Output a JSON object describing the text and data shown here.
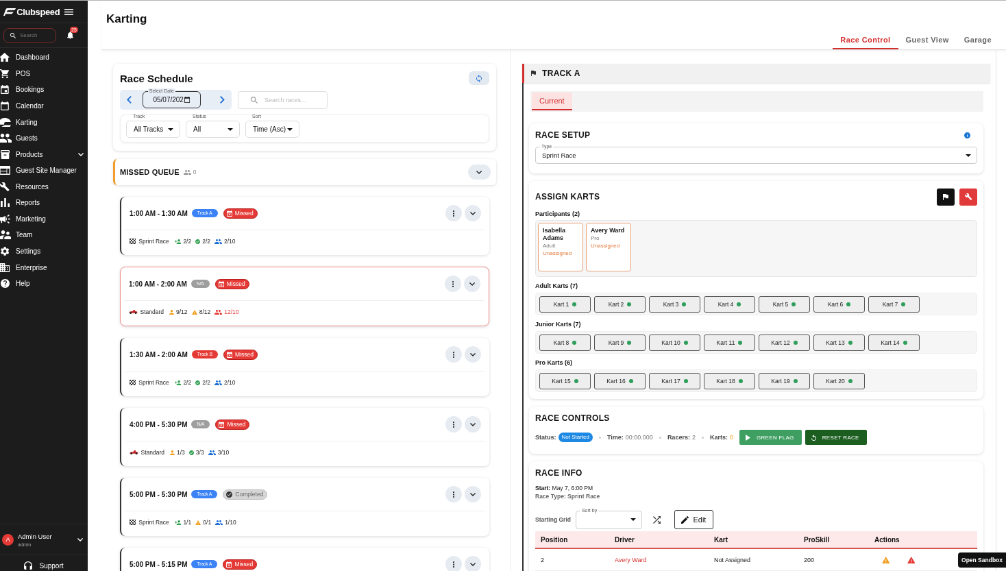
{
  "sidebar": {
    "brand": "Clubspeed",
    "search": {
      "placeholder": "Search"
    },
    "notification_count": "25",
    "items": [
      {
        "label": "Dashboard",
        "has_submenu": false
      },
      {
        "label": "POS",
        "has_submenu": false
      },
      {
        "label": "Bookings",
        "has_submenu": false
      },
      {
        "label": "Calendar",
        "has_submenu": false
      },
      {
        "label": "Karting",
        "has_submenu": false
      },
      {
        "label": "Guests",
        "has_submenu": false
      },
      {
        "label": "Products",
        "has_submenu": true
      },
      {
        "label": "Guest Site Manager",
        "has_submenu": false
      },
      {
        "label": "Resources",
        "has_submenu": false
      },
      {
        "label": "Reports",
        "has_submenu": false
      },
      {
        "label": "Marketing",
        "has_submenu": false
      },
      {
        "label": "Team",
        "has_submenu": false
      },
      {
        "label": "Settings",
        "has_submenu": false
      },
      {
        "label": "Enterprise",
        "has_submenu": false
      },
      {
        "label": "Help",
        "has_submenu": false
      }
    ],
    "user": {
      "initial": "A",
      "name": "Admin User",
      "role": "admin"
    },
    "support": "Support"
  },
  "header": {
    "title": "Karting",
    "tabs": [
      {
        "label": "Race Control",
        "selected": true
      },
      {
        "label": "Guest View",
        "selected": false
      },
      {
        "label": "Garage",
        "selected": false
      }
    ]
  },
  "schedule": {
    "title": "Race Schedule",
    "date": {
      "label": "Select Date",
      "value": "05/07/202"
    },
    "search": {
      "placeholder": "Search races..."
    },
    "filters": [
      {
        "label": "Track",
        "value": "All Tracks"
      },
      {
        "label": "Status",
        "value": "All"
      },
      {
        "label": "Sort",
        "value": "Time (Asc)"
      }
    ]
  },
  "missed_queue": {
    "title": "MISSED QUEUE",
    "count": "0"
  },
  "races": [
    {
      "time": "1:00 AM - 1:30 AM",
      "track": {
        "label": "Track A",
        "color": "#3b82f6"
      },
      "status": {
        "label": "Missed",
        "kind": "missed"
      },
      "alert": false,
      "type": {
        "label": "Sprint Race",
        "kind": "sprint"
      },
      "stats": [
        {
          "kind": "checkin",
          "value": "2/2",
          "alert": false
        },
        {
          "kind": "ready",
          "value": "2/2",
          "alert": false
        },
        {
          "kind": "capacity",
          "value": "2/10",
          "alert": false
        }
      ]
    },
    {
      "time": "1:00 AM - 2:00 AM",
      "track": {
        "label": "N/A",
        "color": "#9e9e9e"
      },
      "status": {
        "label": "Missed",
        "kind": "missed"
      },
      "alert": true,
      "type": {
        "label": "Standard",
        "kind": "standard"
      },
      "stats": [
        {
          "kind": "checkin",
          "value": "9/12",
          "alert": true
        },
        {
          "kind": "ready",
          "value": "8/12",
          "alert": true
        },
        {
          "kind": "capacity",
          "value": "12/10",
          "alert": true
        }
      ]
    },
    {
      "time": "1:30 AM - 2:00 AM",
      "track": {
        "label": "Track B",
        "color": "#e53935"
      },
      "status": {
        "label": "Missed",
        "kind": "missed"
      },
      "alert": false,
      "type": {
        "label": "Sprint Race",
        "kind": "sprint"
      },
      "stats": [
        {
          "kind": "checkin",
          "value": "2/2",
          "alert": false
        },
        {
          "kind": "ready",
          "value": "2/2",
          "alert": false
        },
        {
          "kind": "capacity",
          "value": "2/10",
          "alert": false
        }
      ]
    },
    {
      "time": "4:00 PM - 5:30 PM",
      "track": {
        "label": "N/A",
        "color": "#9e9e9e"
      },
      "status": {
        "label": "Missed",
        "kind": "missed"
      },
      "alert": false,
      "type": {
        "label": "Standard",
        "kind": "standard"
      },
      "stats": [
        {
          "kind": "checkin",
          "value": "1/3",
          "alert": true
        },
        {
          "kind": "ready",
          "value": "3/3",
          "alert": false
        },
        {
          "kind": "capacity",
          "value": "3/10",
          "alert": false
        }
      ]
    },
    {
      "time": "5:00 PM - 5:30 PM",
      "track": {
        "label": "Track A",
        "color": "#3b82f6"
      },
      "status": {
        "label": "Completed",
        "kind": "completed"
      },
      "alert": false,
      "type": {
        "label": "Sprint Race",
        "kind": "sprint"
      },
      "stats": [
        {
          "kind": "checkin",
          "value": "1/1",
          "alert": false
        },
        {
          "kind": "ready",
          "value": "0/1",
          "alert": true
        },
        {
          "kind": "capacity",
          "value": "1/10",
          "alert": false
        }
      ]
    },
    {
      "time": "5:00 PM - 5:15 PM",
      "track": {
        "label": "Track A",
        "color": "#3b82f6"
      },
      "status": {
        "label": "Missed",
        "kind": "missed"
      },
      "alert": false
    }
  ],
  "track_panel": {
    "title": "TRACK A",
    "tabs": [
      {
        "label": "Current",
        "selected": true
      }
    ],
    "race_setup": {
      "title": "RACE SETUP",
      "type": {
        "label": "Type",
        "value": "Sprint Race"
      }
    },
    "assign_karts": {
      "title": "ASSIGN KARTS",
      "participants": {
        "label": "Participants (2)",
        "items": [
          {
            "name": "Isabella Adams",
            "category": "Adult",
            "assignment": "Unassigned",
            "assigned": false
          },
          {
            "name": "Avery Ward",
            "category": "Pro",
            "assignment": "Unassigned",
            "assigned": false
          }
        ]
      },
      "kart_groups": [
        {
          "label": "Adult Karts (7)",
          "karts": [
            {
              "label": "Kart 1",
              "available": true
            },
            {
              "label": "Kart 2",
              "available": true
            },
            {
              "label": "Kart 3",
              "available": true
            },
            {
              "label": "Kart 4",
              "available": true
            },
            {
              "label": "Kart 5",
              "available": true
            },
            {
              "label": "Kart 6",
              "available": true
            },
            {
              "label": "Kart 7",
              "available": true
            }
          ]
        },
        {
          "label": "Junior Karts (7)",
          "karts": [
            {
              "label": "Kart 8",
              "available": true
            },
            {
              "label": "Kart 9",
              "available": true
            },
            {
              "label": "Kart 10",
              "available": true
            },
            {
              "label": "Kart 11",
              "available": true
            },
            {
              "label": "Kart 12",
              "available": true
            },
            {
              "label": "Kart 13",
              "available": true
            },
            {
              "label": "Kart 14",
              "available": true
            }
          ]
        },
        {
          "label": "Pro Karts (6)",
          "karts": [
            {
              "label": "Kart 15",
              "available": true
            },
            {
              "label": "Kart 16",
              "available": true
            },
            {
              "label": "Kart 17",
              "available": true
            },
            {
              "label": "Kart 18",
              "available": true
            },
            {
              "label": "Kart 19",
              "available": true
            },
            {
              "label": "Kart 20",
              "available": true
            }
          ]
        }
      ]
    },
    "race_controls": {
      "title": "RACE CONTROLS",
      "status": {
        "label": "Status:",
        "value": "Not Started"
      },
      "readouts": [
        {
          "label": "Time:",
          "value": "00:00.000",
          "warning": false
        },
        {
          "label": "Racers:",
          "value": "2",
          "warning": false
        },
        {
          "label": "Karts:",
          "value": "0",
          "warning": true
        }
      ],
      "buttons": [
        {
          "label": "GREEN FLAG",
          "kind": "start"
        },
        {
          "label": "RESET RACE",
          "kind": "reset"
        }
      ]
    },
    "race_info": {
      "title": "RACE INFO",
      "start": "**Start:** May 7, 6:00 PM",
      "race_type": "Race Type: Sprint Race",
      "starting_grid": {
        "label": "Starting Grid",
        "sort": {
          "label": "Sort by"
        },
        "edit": "Edit"
      },
      "table": {
        "columns": [
          "Position",
          "Driver",
          "Kart",
          "ProSkill",
          "Actions"
        ],
        "rows": [
          {
            "cells": [
              "2",
              "Avery Ward",
              "Not Assigned",
              "200"
            ],
            "actions": [
              {
                "kind": "warning"
              },
              {
                "kind": "error"
              }
            ]
          }
        ]
      }
    }
  },
  "sandbox_button": "Open Sandbox"
}
